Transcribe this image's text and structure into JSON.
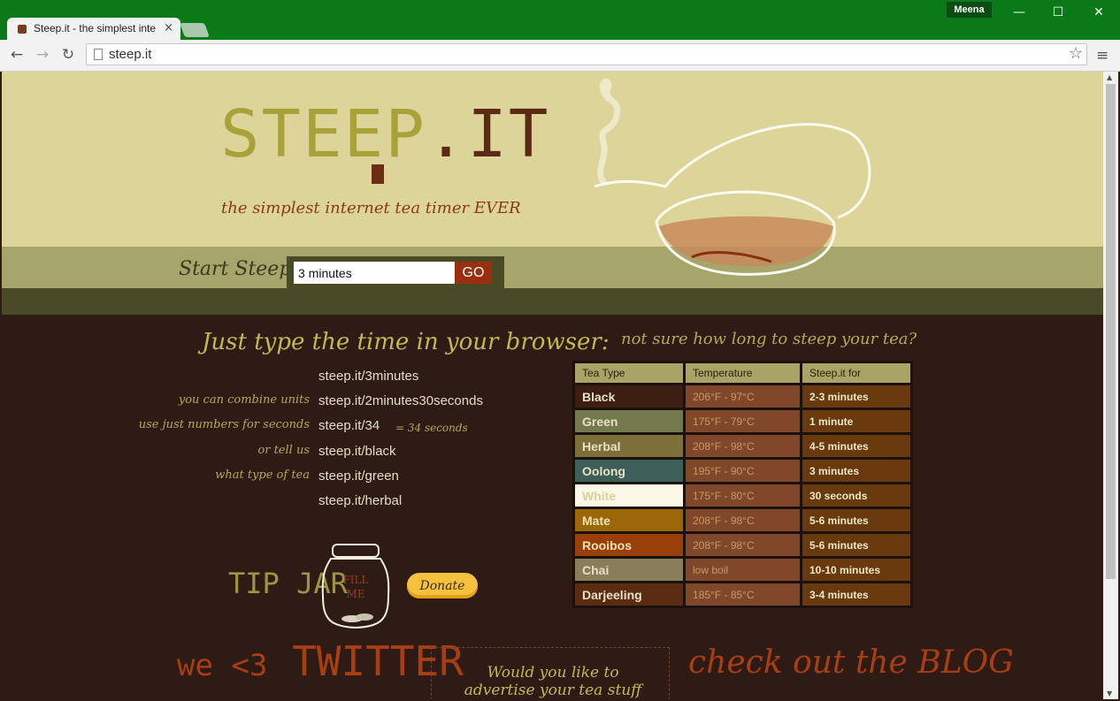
{
  "browser": {
    "tab_title": "Steep.it - the simplest inte",
    "tab_close": "×",
    "profile_name": "Meena",
    "win_minimize": "—",
    "win_maximize": "☐",
    "win_close": "✕",
    "back": "←",
    "forward": "→",
    "reload": "↻",
    "url": "steep.it",
    "star": "☆",
    "menu": "≡",
    "scroll_up": "▲",
    "scroll_down": "▼"
  },
  "hero": {
    "brand_part1": "STEEP",
    "brand_part2": ".IT",
    "tagline": "the simplest internet tea timer EVER",
    "start_label": "Start Steeping",
    "timer_value": "3 minutes",
    "go_label": "GO"
  },
  "instructions": {
    "title": "Just type the time in your browser:",
    "rows": [
      {
        "note": "",
        "url": "steep.it/3minutes",
        "suffix": ""
      },
      {
        "note": "you can combine units",
        "url": "steep.it/2minutes30seconds",
        "suffix": ""
      },
      {
        "note": "use just numbers for seconds",
        "url": "steep.it/34",
        "suffix": "= 34 seconds"
      },
      {
        "note": "or tell us",
        "url": "steep.it/black",
        "suffix": ""
      },
      {
        "note": "what type of tea",
        "url": "steep.it/green",
        "suffix": ""
      },
      {
        "note": "",
        "url": "steep.it/herbal",
        "suffix": ""
      }
    ]
  },
  "tipjar": {
    "label": "TIP JAR",
    "jar_text_1": "FILL",
    "jar_text_2": "ME",
    "donate_label": "Donate"
  },
  "footer": {
    "twitter_prefix": "we <3",
    "twitter_word": "TWITTER",
    "ad_text": "Would you like to advertise your tea stuff here? Inquire Within",
    "blog": "check out the BLOG"
  },
  "tea_table": {
    "title": "not sure how long to steep your tea?",
    "headers": [
      "Tea Type",
      "Temperature",
      "Steep.it for"
    ],
    "rows": [
      {
        "name": "Black",
        "temp": "206°F - 97°C",
        "time": "2-3 minutes",
        "bg": "#3d1e12",
        "fg": "#e9dfc6"
      },
      {
        "name": "Green",
        "temp": "175°F - 79°C",
        "time": "1 minute",
        "bg": "#747a4e",
        "fg": "#e9dfc6"
      },
      {
        "name": "Herbal",
        "temp": "208°F - 98°C",
        "time": "4-5 minutes",
        "bg": "#7d6f3a",
        "fg": "#e9dfc6"
      },
      {
        "name": "Oolong",
        "temp": "195°F - 90°C",
        "time": "3 minutes",
        "bg": "#3e5e58",
        "fg": "#e9dfc6"
      },
      {
        "name": "White",
        "temp": "175°F - 80°C",
        "time": "30 seconds",
        "bg": "#fbf7e6",
        "fg": "#d9cf9c"
      },
      {
        "name": "Mate",
        "temp": "208°F - 98°C",
        "time": "5-6 minutes",
        "bg": "#9b6709",
        "fg": "#efe2b4"
      },
      {
        "name": "Rooibos",
        "temp": "208°F - 98°C",
        "time": "5-6 minutes",
        "bg": "#993f0a",
        "fg": "#efe2b4"
      },
      {
        "name": "Chai",
        "temp": "low boil",
        "time": "10-10 minutes",
        "bg": "#8a7d5b",
        "fg": "#e9dfc6"
      },
      {
        "name": "Darjeeling",
        "temp": "185°F - 85°C",
        "time": "3-4 minutes",
        "bg": "#5a2d12",
        "fg": "#e9dfc6"
      }
    ]
  }
}
